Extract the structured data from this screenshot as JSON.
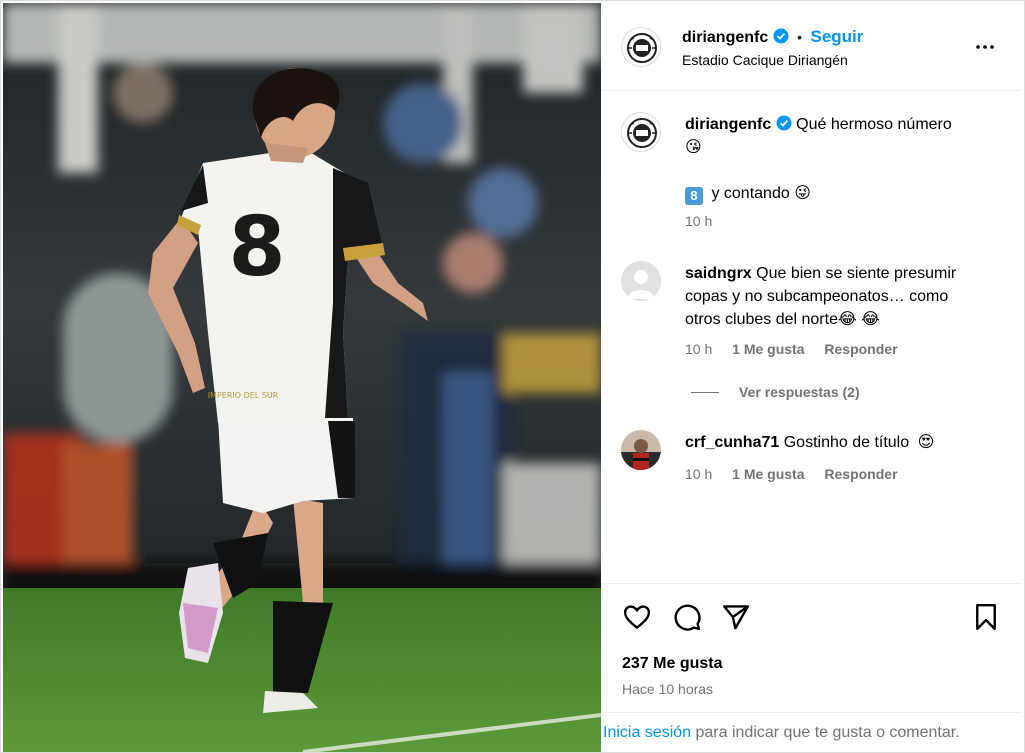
{
  "header": {
    "username": "diriangenfc",
    "dot": "•",
    "follow_label": "Seguir",
    "location": "Estadio Cacique Diriangén",
    "more_icon": "more-horizontal-icon"
  },
  "media": {
    "jersey_number": "8",
    "jersey_text": "IMPERIO DEL SUR"
  },
  "caption": {
    "username": "diriangenfc",
    "text_line1": "Qué hermoso número",
    "emoji1": "😘",
    "keycap": "8",
    "text_line2": "y contando",
    "emoji2": "😜",
    "time": "10 h"
  },
  "comments": [
    {
      "username": "saidngrx",
      "text_line1": "Que bien se siente presumir",
      "text_line2": "copas y no subcampeonatos… como",
      "text_line3": "otros clubes del norte",
      "emojis": "😂 😂",
      "time": "10 h",
      "likes": "1 Me gusta",
      "reply": "Responder",
      "view_replies": "Ver respuestas (2)"
    },
    {
      "username": "crf_cunha71",
      "text": "Gostinho de título",
      "emoji": "😍",
      "time": "10 h",
      "likes": "1 Me gusta",
      "reply": "Responder"
    }
  ],
  "actions": {
    "likes": "237 Me gusta",
    "posted": "Hace 10 horas",
    "icons": [
      "heart-icon",
      "comment-icon",
      "share-icon",
      "bookmark-icon"
    ]
  },
  "login": {
    "link": "Inicia sesión",
    "rest": "para indicar que te gusta o comentar."
  },
  "colors": {
    "link_blue": "#0095f6",
    "verified_blue": "#0095f6",
    "muted_gray": "#737373",
    "pitch_green": "#4f8a2f"
  }
}
